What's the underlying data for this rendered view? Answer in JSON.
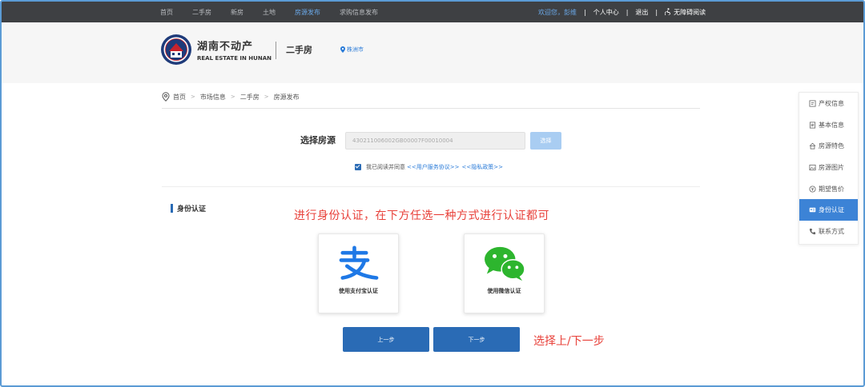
{
  "topnav": {
    "items": [
      {
        "label": "首页"
      },
      {
        "label": "二手房"
      },
      {
        "label": "新房"
      },
      {
        "label": "土地"
      },
      {
        "label": "房源发布",
        "active": true
      },
      {
        "label": "求购信息发布"
      }
    ],
    "welcome": "欢迎您，彭维",
    "personal_center": "个人中心",
    "logout": "退出",
    "accessibility": "无障碍阅读",
    "accessibility_icon": "accessibility-icon"
  },
  "header": {
    "brand_cn": "湖南不动产",
    "brand_en": "REAL ESTATE IN HUNAN",
    "section": "二手房",
    "city": "株洲市",
    "city_icon": "location-pin-icon"
  },
  "breadcrumb": {
    "icon": "location-pin-icon",
    "items": [
      "首页",
      "市场信息",
      "二手房",
      "房源发布"
    ],
    "separator": ">"
  },
  "select_source": {
    "label": "选择房源",
    "value": "430211006002GB00007F00010004",
    "button": "选择"
  },
  "agreement": {
    "checked": true,
    "text": "我已阅读并同意",
    "user_agreement": "<<用户服务协议>>",
    "privacy_policy": "<<隐私政策>>"
  },
  "identity": {
    "title": "身份认证",
    "note": "进行身份认证，在下方任选一种方式进行认证都可",
    "methods": [
      {
        "label": "使用支付宝认证",
        "icon": "alipay-icon"
      },
      {
        "label": "使用微信认证",
        "icon": "wechat-icon"
      }
    ]
  },
  "buttons": {
    "prev": "上一步",
    "next": "下一步",
    "note": "选择上/下一步"
  },
  "side_nav": [
    {
      "label": "产权信息",
      "icon": "certificate-icon"
    },
    {
      "label": "基本信息",
      "icon": "document-icon"
    },
    {
      "label": "房源特色",
      "icon": "house-icon"
    },
    {
      "label": "房源图片",
      "icon": "image-icon"
    },
    {
      "label": "期望售价",
      "icon": "price-icon"
    },
    {
      "label": "身份认证",
      "icon": "id-card-icon",
      "active": true
    },
    {
      "label": "联系方式",
      "icon": "phone-icon"
    }
  ],
  "colors": {
    "accent": "#2a6bb5",
    "link": "#2a7bd8",
    "annotation": "#e8413a",
    "topbar": "#3e4043"
  }
}
